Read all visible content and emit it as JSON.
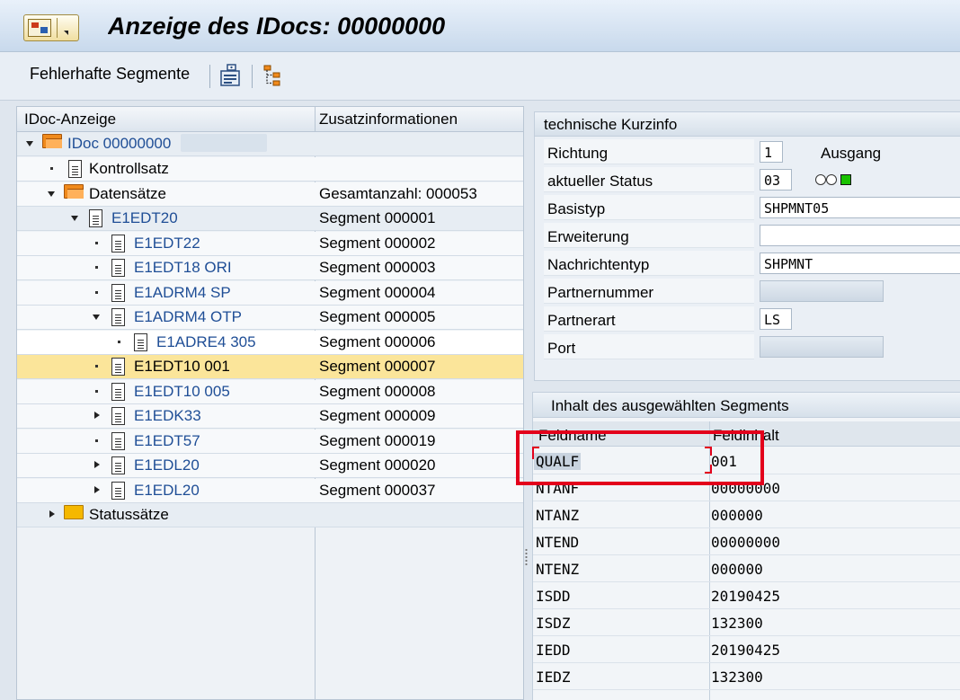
{
  "window": {
    "title": "Anzeige des IDocs: 00000000"
  },
  "toolbar": {
    "erroneous_segments": "Fehlerhafte Segmente",
    "tech_info_icon": "technical-info-icon",
    "tree_icon": "tree-structure-icon"
  },
  "tree": {
    "header_col1": "IDoc-Anzeige",
    "header_col2": "Zusatzinformationen",
    "rows": [
      {
        "label": "IDoc 00000000",
        "info": ""
      },
      {
        "label": "Kontrollsatz",
        "info": ""
      },
      {
        "label": "Datensätze",
        "info": "Gesamtanzahl: 000053"
      },
      {
        "label": "E1EDT20",
        "info": "Segment 000001"
      },
      {
        "label": "E1EDT22",
        "info": "Segment 000002"
      },
      {
        "label": "E1EDT18 ORI",
        "info": "Segment 000003"
      },
      {
        "label": "E1ADRM4 SP",
        "info": "Segment 000004"
      },
      {
        "label": "E1ADRM4 OTP",
        "info": "Segment 000005"
      },
      {
        "label": "E1ADRE4 305",
        "info": "Segment 000006"
      },
      {
        "label": "E1EDT10 001",
        "info": "Segment 000007"
      },
      {
        "label": "E1EDT10 005",
        "info": "Segment 000008"
      },
      {
        "label": "E1EDK33",
        "info": "Segment 000009"
      },
      {
        "label": "E1EDT57",
        "info": "Segment 000019"
      },
      {
        "label": "E1EDL20",
        "info": "Segment 000020"
      },
      {
        "label": "E1EDL20",
        "info": "Segment 000037"
      },
      {
        "label": "Statussätze",
        "info": ""
      }
    ]
  },
  "tech_info": {
    "title": "technische Kurzinfo",
    "richtung_label": "Richtung",
    "richtung_value": "1",
    "richtung_text": "Ausgang",
    "status_label": "aktueller Status",
    "status_value": "03",
    "basistyp_label": "Basistyp",
    "basistyp_value": "SHPMNT05",
    "erweiterung_label": "Erweiterung",
    "erweiterung_value": "",
    "nachrichtentyp_label": "Nachrichtentyp",
    "nachrichtentyp_value": "SHPMNT",
    "partnernummer_label": "Partnernummer",
    "partnerart_label": "Partnerart",
    "partnerart_value": "LS",
    "port_label": "Port"
  },
  "segment": {
    "title": "Inhalt des ausgewählten Segments",
    "col_name": "Feldname",
    "col_value": "Feldinhalt",
    "rows": [
      {
        "name": "QUALF",
        "value": "001"
      },
      {
        "name": "NTANF",
        "value": "00000000"
      },
      {
        "name": "NTANZ",
        "value": "000000"
      },
      {
        "name": "NTEND",
        "value": "00000000"
      },
      {
        "name": "NTENZ",
        "value": "000000"
      },
      {
        "name": "ISDD",
        "value": "20190425"
      },
      {
        "name": "ISDZ",
        "value": "132300"
      },
      {
        "name": "IEDD",
        "value": "20190425"
      },
      {
        "name": "IEDZ",
        "value": "132300"
      }
    ]
  },
  "colors": {
    "selected_row": "#fbe59a",
    "highlight": "#e3001b",
    "link_blue": "#1f4e96",
    "status_green": "#19c100"
  }
}
